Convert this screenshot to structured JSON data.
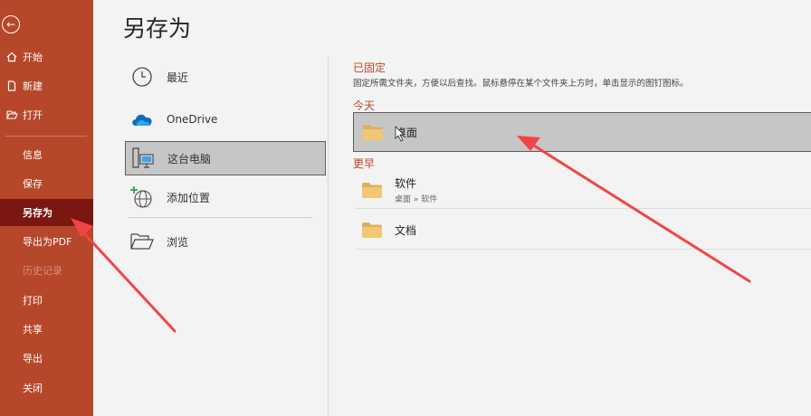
{
  "page_title": "另存为",
  "sidebar": {
    "items": [
      {
        "label": "开始",
        "icon": "home-icon"
      },
      {
        "label": "新建",
        "icon": "new-document-icon"
      },
      {
        "label": "打开",
        "icon": "open-folder-icon"
      },
      {
        "label": "信息"
      },
      {
        "label": "保存"
      },
      {
        "label": "另存为",
        "active": true
      },
      {
        "label": "导出为PDF"
      },
      {
        "label": "历史记录",
        "disabled": true
      },
      {
        "label": "打印"
      },
      {
        "label": "共享"
      },
      {
        "label": "导出"
      },
      {
        "label": "关闭"
      }
    ]
  },
  "locations": [
    {
      "label": "最近",
      "icon": "clock-icon"
    },
    {
      "label": "OneDrive",
      "icon": "cloud-icon"
    },
    {
      "label": "这台电脑",
      "icon": "computer-icon",
      "selected": true
    },
    {
      "label": "添加位置",
      "icon": "globe-add-icon"
    },
    {
      "label": "浏览",
      "icon": "folder-open-icon"
    }
  ],
  "pinned": {
    "heading": "已固定",
    "description": "固定所需文件夹，方便以后查找。鼠标悬停在某个文件夹上方时，单击显示的图钉图标。"
  },
  "today": {
    "heading": "今天",
    "folders": [
      {
        "name": "桌面"
      }
    ]
  },
  "earlier": {
    "heading": "更早",
    "folders": [
      {
        "name": "软件",
        "path": "桌面 » 软件"
      },
      {
        "name": "文档"
      }
    ]
  },
  "colors": {
    "sidebar": "#b7472a",
    "sidebar_active": "#7a1710",
    "accent_text": "#b7472a",
    "annotation_arrow": "#f04545"
  }
}
